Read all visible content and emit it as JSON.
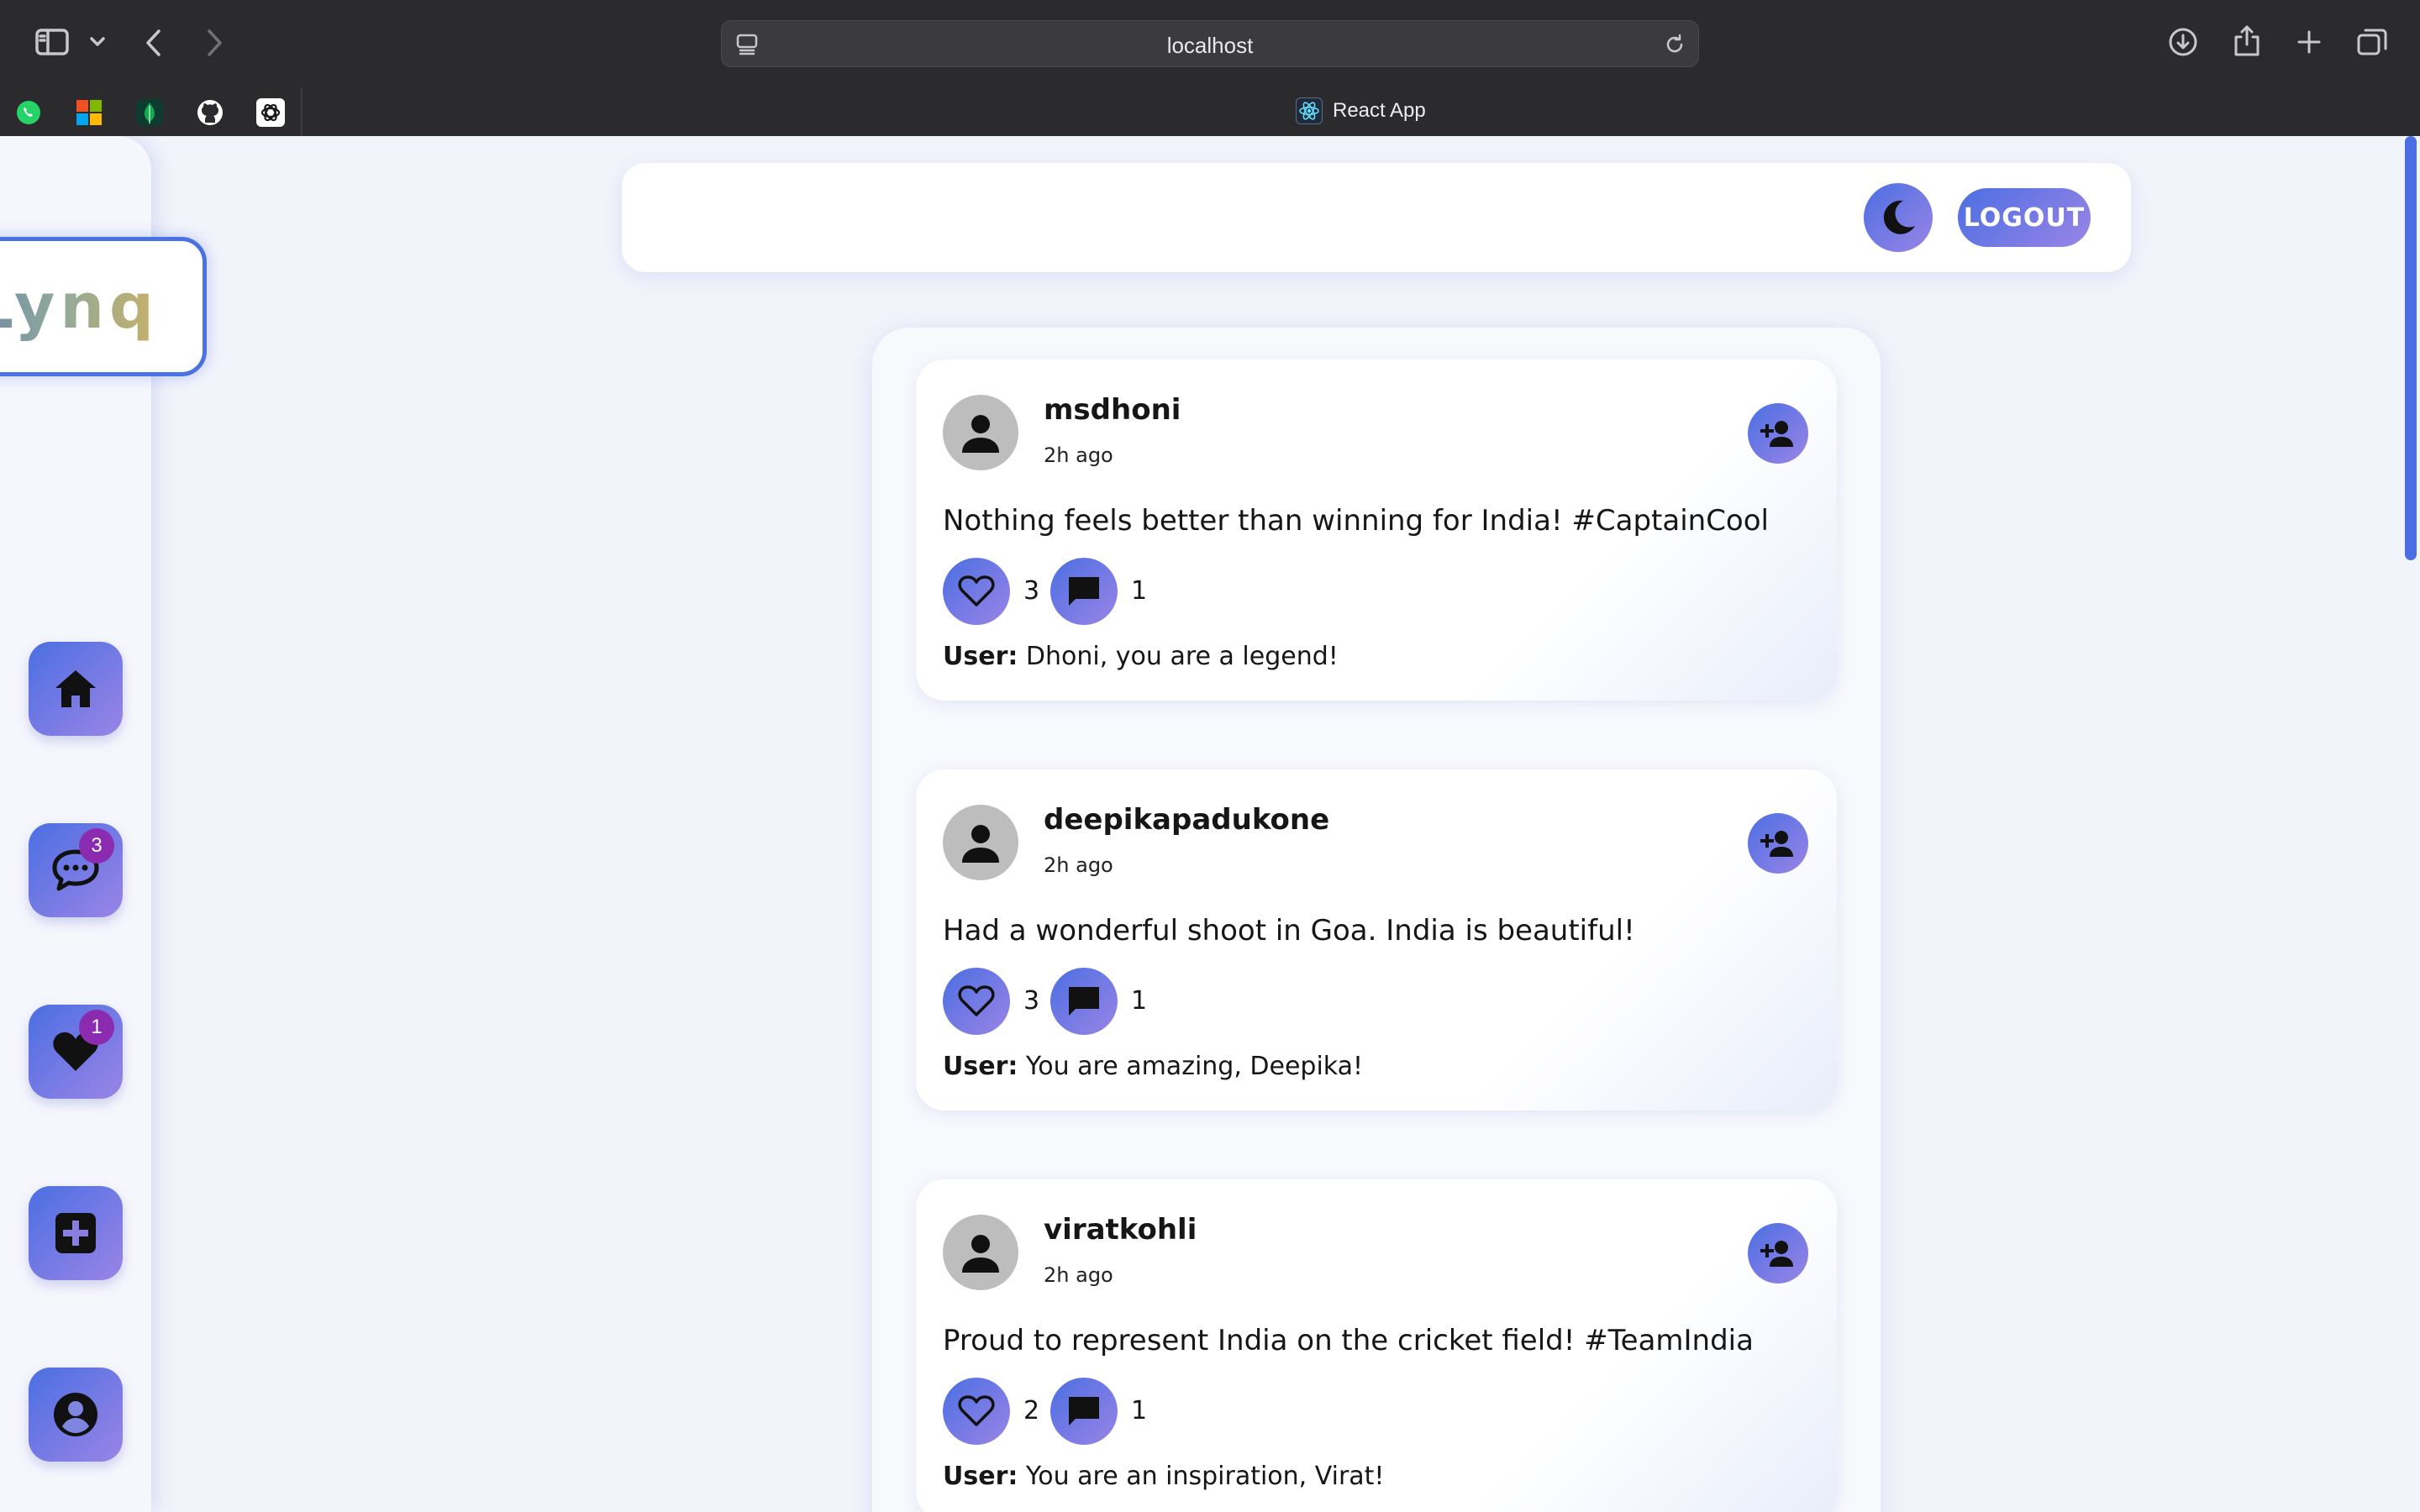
{
  "browser": {
    "url": "localhost",
    "tab_title": "React App",
    "bookmarks": [
      "whatsapp-icon",
      "microsoft-icon",
      "mongodb-icon",
      "github-icon",
      "openai-icon"
    ]
  },
  "app": {
    "logo_text": "Lynq",
    "logout_label": "LOGOUT",
    "colors": {
      "accent_start": "#4b6fe2",
      "accent_end": "#9a84e6",
      "badge": "#8b2bb0"
    }
  },
  "sidebar": {
    "items": [
      {
        "name": "home",
        "icon": "home-icon",
        "badge": ""
      },
      {
        "name": "messages",
        "icon": "chat-icon",
        "badge": "3"
      },
      {
        "name": "notifications",
        "icon": "heart-icon",
        "badge": "1"
      },
      {
        "name": "create",
        "icon": "plus-icon",
        "badge": ""
      },
      {
        "name": "profile",
        "icon": "user-icon",
        "badge": ""
      }
    ]
  },
  "posts": [
    {
      "username": "msdhoni",
      "time": "2h ago",
      "text": "Nothing feels better than winning for India! #CaptainCool",
      "likes": "3",
      "comments": "1",
      "comment_author": "User:",
      "comment_text": "Dhoni, you are a legend!"
    },
    {
      "username": "deepikapadukone",
      "time": "2h ago",
      "text": "Had a wonderful shoot in Goa. India is beautiful!",
      "likes": "3",
      "comments": "1",
      "comment_author": "User:",
      "comment_text": "You are amazing, Deepika!"
    },
    {
      "username": "viratkohli",
      "time": "2h ago",
      "text": "Proud to represent India on the cricket field! #TeamIndia",
      "likes": "2",
      "comments": "1",
      "comment_author": "User:",
      "comment_text": "You are an inspiration, Virat!"
    }
  ]
}
